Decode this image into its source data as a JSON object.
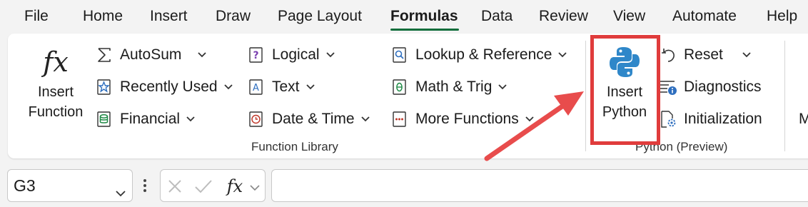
{
  "tabs": [
    "File",
    "Home",
    "Insert",
    "Draw",
    "Page Layout",
    "Formulas",
    "Data",
    "Review",
    "View",
    "Automate",
    "Help"
  ],
  "active_tab": "Formulas",
  "function_library": {
    "insert_function": {
      "line1": "Insert",
      "line2": "Function",
      "icon": "fx-icon"
    },
    "col1": [
      {
        "label": "AutoSum",
        "icon": "sigma-icon"
      },
      {
        "label": "Recently Used",
        "icon": "star-icon"
      },
      {
        "label": "Financial",
        "icon": "financial-icon"
      }
    ],
    "col2": [
      {
        "label": "Logical",
        "icon": "question-book-icon"
      },
      {
        "label": "Text",
        "icon": "text-book-icon"
      },
      {
        "label": "Date & Time",
        "icon": "clock-book-icon"
      }
    ],
    "col3": [
      {
        "label": "Lookup & Reference",
        "icon": "search-book-icon"
      },
      {
        "label": "Math & Trig",
        "icon": "theta-book-icon"
      },
      {
        "label": "More Functions",
        "icon": "dots-book-icon"
      }
    ],
    "group_label": "Function Library"
  },
  "python": {
    "insert_python": {
      "line1": "Insert",
      "line2": "Python",
      "icon": "python-icon"
    },
    "reset": "Reset",
    "diagnostics": "Diagnostics",
    "initialization": "Initialization",
    "group_label": "Python (Preview)"
  },
  "overflow_letter": "M",
  "formula_bar": {
    "name_box": "G3",
    "formula_value": ""
  },
  "colors": {
    "accent": "#0e6d3b",
    "highlight_box": "#e03c3c",
    "arrow": "#e84c4c",
    "python_blue": "#2f87c9"
  }
}
